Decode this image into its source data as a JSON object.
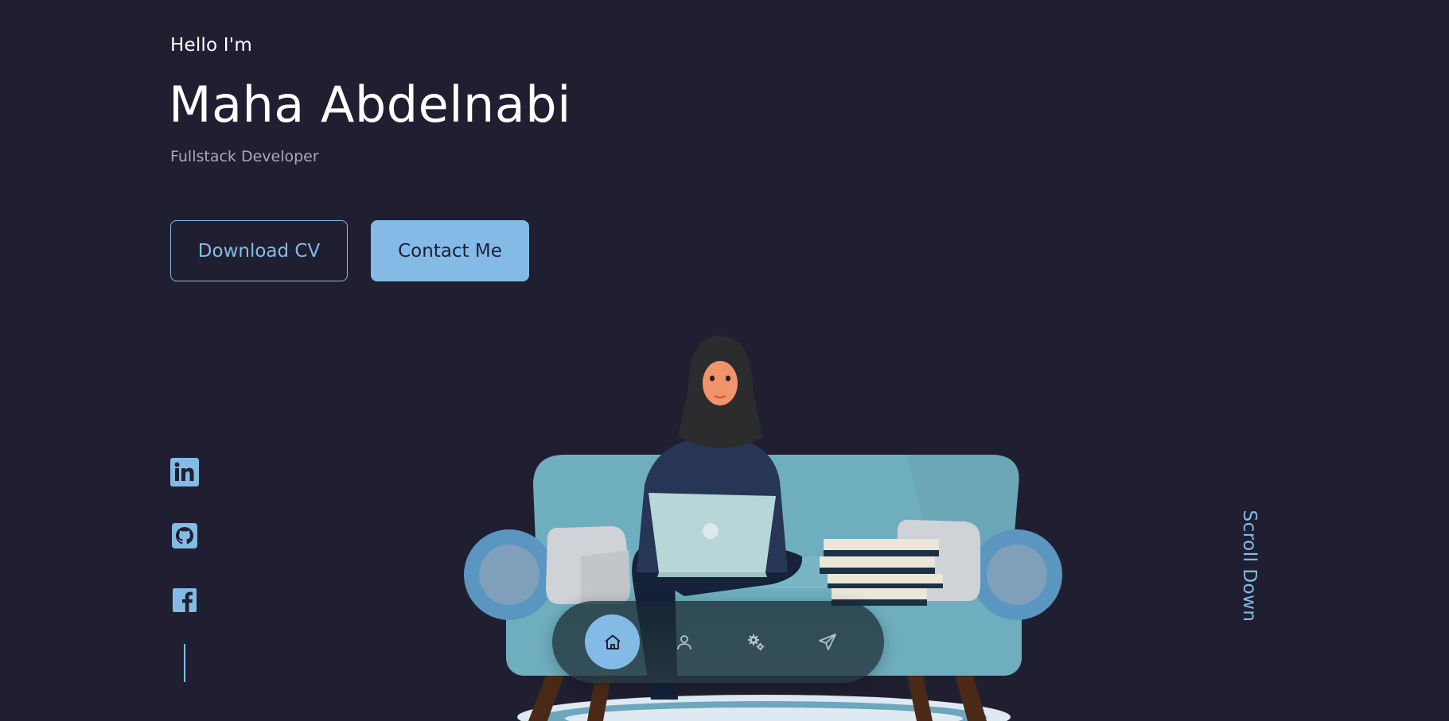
{
  "hero": {
    "greeting": "Hello I'm",
    "name": "Maha Abdelnabi",
    "role": "Fullstack Developer",
    "download_cv_label": "Download CV",
    "contact_label": "Contact Me"
  },
  "social": [
    {
      "name": "linkedin",
      "icon": "linkedin-icon"
    },
    {
      "name": "github",
      "icon": "github-icon"
    },
    {
      "name": "facebook",
      "icon": "facebook-icon"
    }
  ],
  "scroll_down_label": "Scroll Down",
  "nav": {
    "items": [
      {
        "icon": "home-icon",
        "active": true
      },
      {
        "icon": "user-icon",
        "active": false
      },
      {
        "icon": "gears-icon",
        "active": false
      },
      {
        "icon": "send-icon",
        "active": false
      }
    ]
  },
  "colors": {
    "background": "#201f31",
    "accent": "#84bbe6",
    "text": "#ffffff",
    "muted": "#a9a9b3",
    "dark_text": "#1f2037"
  }
}
